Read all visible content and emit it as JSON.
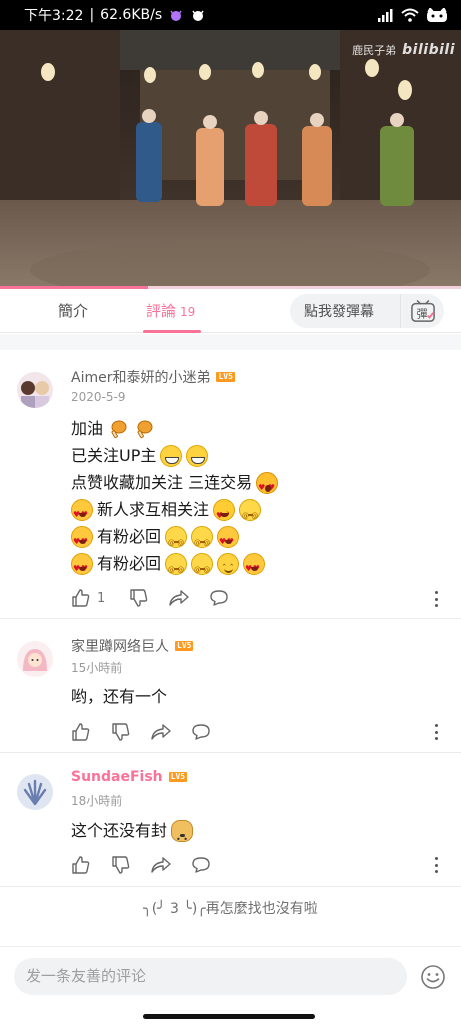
{
  "status_bar": {
    "time": "下午3:22",
    "separator": "|",
    "network_speed": "62.6KB/s"
  },
  "video": {
    "watermark_channel": "鹿民子弟",
    "watermark_logo": "bilibili",
    "progress": 0.32
  },
  "tabs": {
    "intro": "簡介",
    "comments": "評論",
    "comments_count": "19",
    "danmaku_placeholder": "點我發彈幕",
    "danmaku_button": "彈"
  },
  "comments": [
    {
      "username": "Aimer和泰妍的小迷弟",
      "level": "LV5",
      "time": "2020-5-9",
      "lines": [
        {
          "text": "加油",
          "emojis": [
            "drumstick",
            "drumstick"
          ]
        },
        {
          "text": "已关注UP主",
          "emojis": [
            "grin",
            "grin"
          ]
        },
        {
          "text": "点赞收藏加关注 三连交易",
          "emojis": [
            "shock"
          ]
        },
        {
          "pre_emoji": "hearts",
          "text": "新人求互相关注",
          "emojis": [
            "wink",
            "dizzy"
          ]
        },
        {
          "pre_emoji": "hearts",
          "text": "有粉必回",
          "emojis": [
            "dizzy",
            "dizzy",
            "hearts"
          ]
        },
        {
          "pre_emoji": "hearts",
          "text": "有粉必回",
          "emojis": [
            "dizzy",
            "dizzy",
            "smile",
            "hearts"
          ]
        }
      ],
      "likes": "1"
    },
    {
      "username": "家里蹲网络巨人",
      "level": "LV5",
      "time": "15小時前",
      "text": "哟，还有一个",
      "likes": ""
    },
    {
      "username": "SundaeFish",
      "level": "LV5",
      "time": "18小時前",
      "text": "这个还没有封",
      "emojis": [
        "doge"
      ],
      "likes": ""
    }
  ],
  "end_note": "╮(╯ 3 ╰)╭再怎麼找也沒有啦",
  "bottom_bar": {
    "input_placeholder": "发一条友善的评论"
  },
  "colors": {
    "accent": "#fb7299",
    "level_badge": "#ff9a1f"
  }
}
